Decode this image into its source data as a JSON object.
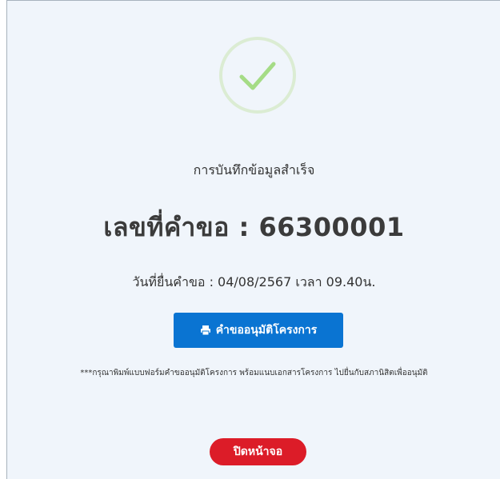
{
  "dialog": {
    "icon": "check-icon",
    "success_message": "การบันทึกข้อมูลสำเร็จ",
    "request_number_text": "เลขที่คำขอ : 66300001",
    "submit_date_text": "วันที่ยื่นคำขอ : 04/08/2567 เวลา 09.40น.",
    "print_button_label": "คำขออนุมัติโครงการ",
    "print_button_icon": "printer-icon",
    "note_text": "***กรุณาพิมพ์แบบฟอร์มคำขออนุมัติโครงการ พร้อมแนบเอกสารโครงการ ไปยื่นกับสภานิสิตเพื่ออนุมัติ",
    "close_button_label": "ปิดหน้าจอ"
  },
  "colors": {
    "panel_background": "#f0f5fb",
    "check_color": "#a5dc86",
    "primary_button": "#0a74d2",
    "danger_button": "#dc1c28"
  }
}
